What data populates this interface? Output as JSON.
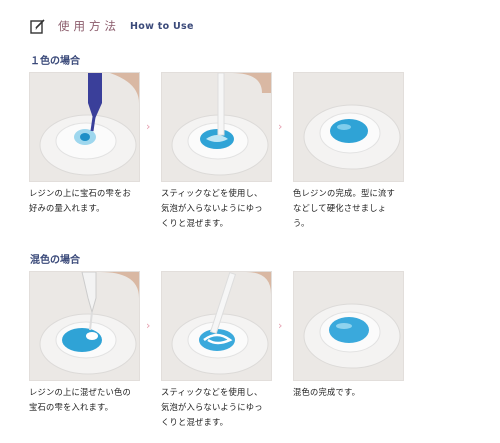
{
  "header": {
    "icon": "edit-icon",
    "title_jp": "使用方法",
    "title_en": "How to Use"
  },
  "sections": [
    {
      "title": "１色の場合",
      "steps": [
        {
          "caption": "レジンの上に宝石の雫をお\n好みの量入れます。"
        },
        {
          "caption": "スティックなどを使用し、\n気泡が入らないようにゆっ\nくりと混ぜます。"
        },
        {
          "caption": "色レジンの完成。型に流す\nなどして硬化させましょ\nう。"
        }
      ]
    },
    {
      "title": "混色の場合",
      "steps": [
        {
          "caption": "レジンの上に混ぜたい色の\n宝石の雫を入れます。"
        },
        {
          "caption": "スティックなどを使用し、\n気泡が入らないようにゆっ\nくりと混ぜます。"
        },
        {
          "caption": "混色の完成です。"
        }
      ]
    }
  ],
  "arrow_glyph": "›",
  "colors": {
    "accent_title": "#3b4a7a",
    "arrow": "#e6a0b0",
    "resin_blue": "#2fa3d6"
  }
}
